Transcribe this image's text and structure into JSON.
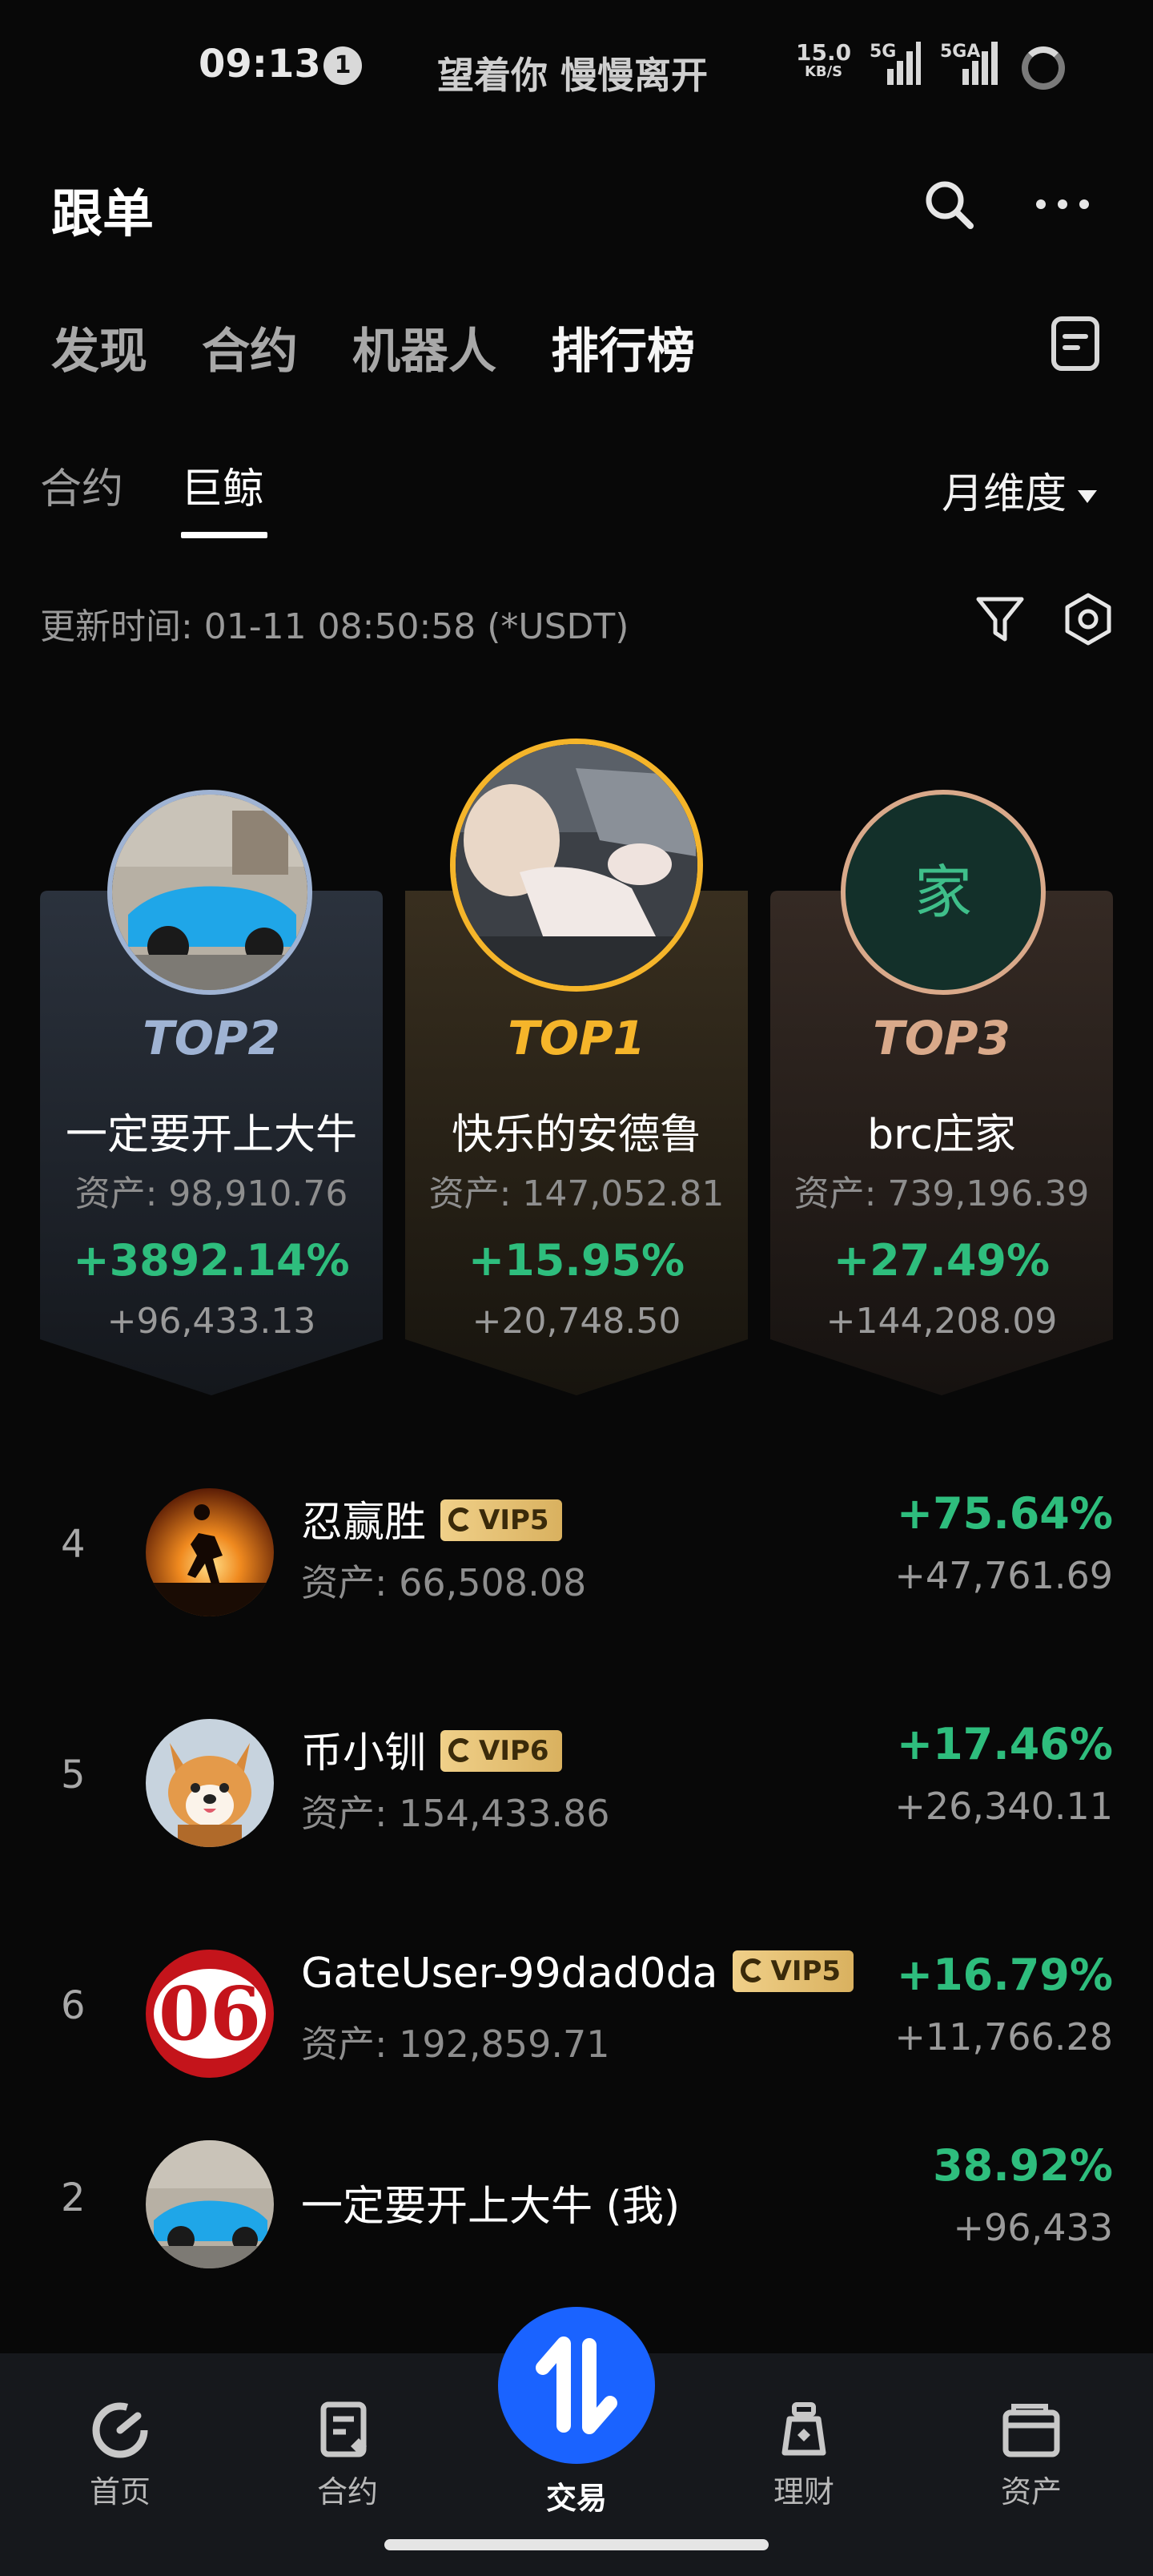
{
  "status_bar": {
    "time": "09:13",
    "notification_count": "1",
    "song": "望着你 慢慢离开",
    "speed_value": "15.0",
    "speed_unit": "KB/S",
    "signal1_label": "5G",
    "signal2_label": "5GA"
  },
  "header": {
    "title": "跟单",
    "icons": [
      "search-icon",
      "more-icon"
    ]
  },
  "main_tabs": [
    {
      "label": "发现",
      "active": false
    },
    {
      "label": "合约",
      "active": false
    },
    {
      "label": "机器人",
      "active": false
    },
    {
      "label": "排行榜",
      "active": true
    }
  ],
  "sub_tabs": [
    {
      "label": "合约",
      "active": false
    },
    {
      "label": "巨鲸",
      "active": true
    }
  ],
  "period_label": "月维度",
  "update_text": "更新时间: 01-11 08:50:58 (*USDT)",
  "podium": [
    {
      "rank": "TOP2",
      "name": "一定要开上大牛",
      "asset": "资产: 98,910.76",
      "pct": "+3892.14%",
      "pnl": "+96,433.13",
      "rank_color": "#9fb3d3"
    },
    {
      "rank": "TOP1",
      "name": "快乐的安德鲁",
      "asset": "资产: 147,052.81",
      "pct": "+15.95%",
      "pnl": "+20,748.50",
      "rank_color": "#f5b52a"
    },
    {
      "rank": "TOP3",
      "name": "brc庄家",
      "asset": "资产: 739,196.39",
      "pct": "+27.49%",
      "pnl": "+144,208.09",
      "rank_color": "#d9a98a",
      "avatar_char": "家"
    }
  ],
  "list": [
    {
      "num": "4",
      "name": "忍赢胜",
      "vip": "VIP5",
      "asset": "资产: 66,508.08",
      "pct": "+75.64%",
      "pnl": "+47,761.69"
    },
    {
      "num": "5",
      "name": "币小钏",
      "vip": "VIP6",
      "asset": "资产: 154,433.86",
      "pct": "+17.46%",
      "pnl": "+26,340.11"
    },
    {
      "num": "6",
      "name": "GateUser-99dad0da",
      "vip": "VIP5",
      "asset": "资产: 192,859.71",
      "pct": "+16.79%",
      "pnl": "+11,766.28",
      "avatar_text": "06"
    }
  ],
  "my_rank": {
    "num": "2",
    "name": "一定要开上大牛 (我)",
    "pct": "38.92%",
    "pnl": "+96,433"
  },
  "bottom_nav": [
    {
      "label": "首页",
      "icon": "home-icon"
    },
    {
      "label": "合约",
      "icon": "contract-icon"
    },
    {
      "label": "交易",
      "icon": "trade-icon"
    },
    {
      "label": "理财",
      "icon": "finance-icon"
    },
    {
      "label": "资产",
      "icon": "wallet-icon"
    }
  ],
  "colors": {
    "positive": "#2ebd7d",
    "accent_blue": "#1a63ff",
    "gold": "#f5b52a"
  }
}
